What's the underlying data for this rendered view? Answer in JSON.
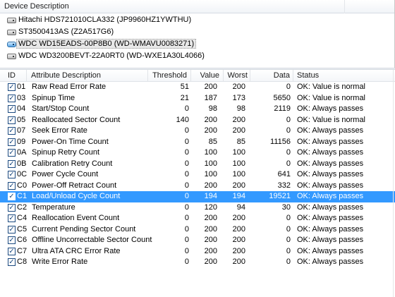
{
  "device_panel": {
    "header": "Device Description",
    "devices": [
      {
        "label": "Hitachi HDS721010CLA332 (JP9960HZ1YWTHU)",
        "icon": "hard-disk-icon"
      },
      {
        "label": "ST3500413AS (Z2A517G6)",
        "icon": "hard-disk-icon"
      },
      {
        "label": "WDC WD15EADS-00P8B0 (WD-WMAVU0083271)",
        "icon": "usb-disk-icon",
        "selected": true
      },
      {
        "label": "WDC WD3200BEVT-22A0RT0 (WD-WXE1A30L4066)",
        "icon": "hard-disk-icon"
      }
    ]
  },
  "attributes": {
    "columns": {
      "id": "ID",
      "description": "Attribute Description",
      "threshold": "Threshold",
      "value": "Value",
      "worst": "Worst",
      "data": "Data",
      "status": "Status"
    },
    "check_mark": "✓",
    "rows": [
      {
        "id": "01",
        "description": "Raw Read Error Rate",
        "threshold": "51",
        "value": "200",
        "worst": "200",
        "data": "0",
        "status": "OK: Value is normal"
      },
      {
        "id": "03",
        "description": "Spinup Time",
        "threshold": "21",
        "value": "187",
        "worst": "173",
        "data": "5650",
        "status": "OK: Value is normal"
      },
      {
        "id": "04",
        "description": "Start/Stop Count",
        "threshold": "0",
        "value": "98",
        "worst": "98",
        "data": "2119",
        "status": "OK: Always passes"
      },
      {
        "id": "05",
        "description": "Reallocated Sector Count",
        "threshold": "140",
        "value": "200",
        "worst": "200",
        "data": "0",
        "status": "OK: Value is normal"
      },
      {
        "id": "07",
        "description": "Seek Error Rate",
        "threshold": "0",
        "value": "200",
        "worst": "200",
        "data": "0",
        "status": "OK: Always passes"
      },
      {
        "id": "09",
        "description": "Power-On Time Count",
        "threshold": "0",
        "value": "85",
        "worst": "85",
        "data": "11156",
        "status": "OK: Always passes"
      },
      {
        "id": "0A",
        "description": "Spinup Retry Count",
        "threshold": "0",
        "value": "100",
        "worst": "100",
        "data": "0",
        "status": "OK: Always passes"
      },
      {
        "id": "0B",
        "description": "Calibration Retry Count",
        "threshold": "0",
        "value": "100",
        "worst": "100",
        "data": "0",
        "status": "OK: Always passes"
      },
      {
        "id": "0C",
        "description": "Power Cycle Count",
        "threshold": "0",
        "value": "100",
        "worst": "100",
        "data": "641",
        "status": "OK: Always passes"
      },
      {
        "id": "C0",
        "description": "Power-Off Retract Count",
        "threshold": "0",
        "value": "200",
        "worst": "200",
        "data": "332",
        "status": "OK: Always passes"
      },
      {
        "id": "C1",
        "description": "Load/Unload Cycle Count",
        "threshold": "0",
        "value": "194",
        "worst": "194",
        "data": "19521",
        "status": "OK: Always passes",
        "selected": true
      },
      {
        "id": "C2",
        "description": "Temperature",
        "threshold": "0",
        "value": "120",
        "worst": "94",
        "data": "30",
        "status": "OK: Always passes"
      },
      {
        "id": "C4",
        "description": "Reallocation Event Count",
        "threshold": "0",
        "value": "200",
        "worst": "200",
        "data": "0",
        "status": "OK: Always passes"
      },
      {
        "id": "C5",
        "description": "Current Pending Sector Count",
        "threshold": "0",
        "value": "200",
        "worst": "200",
        "data": "0",
        "status": "OK: Always passes"
      },
      {
        "id": "C6",
        "description": "Offline Uncorrectable Sector Count",
        "threshold": "0",
        "value": "200",
        "worst": "200",
        "data": "0",
        "status": "OK: Always passes"
      },
      {
        "id": "C7",
        "description": "Ultra ATA CRC Error Rate",
        "threshold": "0",
        "value": "200",
        "worst": "200",
        "data": "0",
        "status": "OK: Always passes"
      },
      {
        "id": "C8",
        "description": "Write Error Rate",
        "threshold": "0",
        "value": "200",
        "worst": "200",
        "data": "0",
        "status": "OK: Always passes"
      }
    ]
  },
  "colors": {
    "selection": "#3399ff",
    "checkbox": "#1c4a80"
  }
}
